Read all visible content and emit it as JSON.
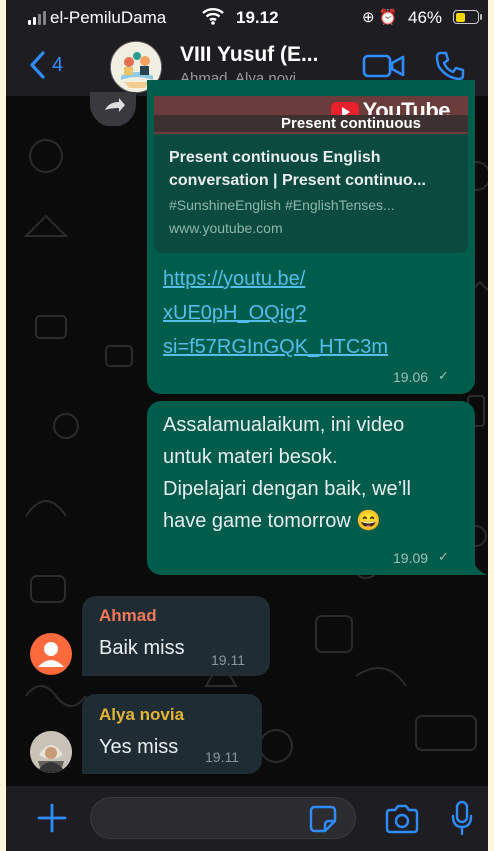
{
  "status_bar": {
    "carrier": "el-PemiluDama",
    "time": "19.12",
    "battery": "46%",
    "battery_level": 0.46
  },
  "header": {
    "back_count": "4",
    "group_name": "VIII Yusuf (E...",
    "members": "Ahmad, Alya novi..."
  },
  "link_message": {
    "thumbnail_brand": "YouTube",
    "thumbnail_caption": "Present continuous",
    "preview_title": "Present continuous English conversation | Present continuo...",
    "preview_tags": "#SunshineEnglish #EnglishTenses...",
    "preview_domain": "www.youtube.com",
    "url_lines": [
      "https://youtu.be/",
      "xUE0pH_OQig?",
      "si=f57RGInGQK_HTC3m"
    ],
    "time": "19.06"
  },
  "text_message": {
    "lines": [
      "Assalamualaikum, ini video",
      "untuk materi besok.",
      "Dipelajari dengan baik, we’ll",
      "have game tomorrow 😄"
    ],
    "time": "19.09"
  },
  "incoming": [
    {
      "sender": "Ahmad",
      "sender_color": "#f0795a",
      "text": "Baik miss",
      "time": "19.11"
    },
    {
      "sender": "Alya novia",
      "sender_color": "#e3b436",
      "text": "Yes miss",
      "time": "19.11"
    }
  ],
  "colors": {
    "accent": "#2f8cff",
    "outgoing_bubble": "#005c4b",
    "incoming_bubble": "#202c33",
    "link": "#53bdeb"
  },
  "icons": [
    "back-chevron-icon",
    "video-call-icon",
    "phone-icon",
    "forward-icon",
    "plus-icon",
    "sticker-icon",
    "camera-icon",
    "microphone-icon",
    "read-tick-icon"
  ],
  "composer": {
    "value": ""
  }
}
